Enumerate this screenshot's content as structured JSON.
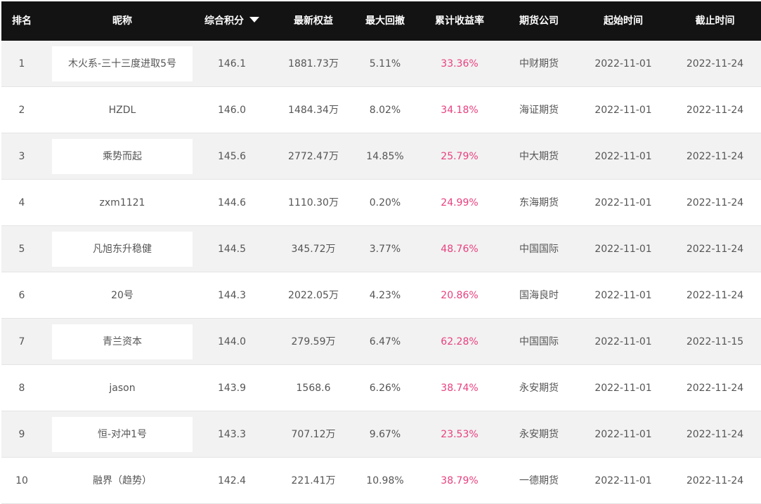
{
  "table": {
    "headers": {
      "rank": "排名",
      "nickname": "昵称",
      "score": "综合积分",
      "equity": "最新权益",
      "drawdown": "最大回撤",
      "return": "累计收益率",
      "firm": "期货公司",
      "start": "起始时间",
      "end": "截止时间"
    },
    "rows": [
      {
        "rank": "1",
        "nickname": "木火系-三十三度进取5号",
        "score": "146.1",
        "equity": "1881.73万",
        "drawdown": "5.11%",
        "return": "33.36%",
        "firm": "中财期货",
        "start": "2022-11-01",
        "end": "2022-11-24"
      },
      {
        "rank": "2",
        "nickname": "HZDL",
        "score": "146.0",
        "equity": "1484.34万",
        "drawdown": "8.02%",
        "return": "34.18%",
        "firm": "海证期货",
        "start": "2022-11-01",
        "end": "2022-11-24"
      },
      {
        "rank": "3",
        "nickname": "乘势而起",
        "score": "145.6",
        "equity": "2772.47万",
        "drawdown": "14.85%",
        "return": "25.79%",
        "firm": "中大期货",
        "start": "2022-11-01",
        "end": "2022-11-24"
      },
      {
        "rank": "4",
        "nickname": "zxm1121",
        "score": "144.6",
        "equity": "1110.30万",
        "drawdown": "0.20%",
        "return": "24.99%",
        "firm": "东海期货",
        "start": "2022-11-01",
        "end": "2022-11-24"
      },
      {
        "rank": "5",
        "nickname": "凡旭东升稳健",
        "score": "144.5",
        "equity": "345.72万",
        "drawdown": "3.77%",
        "return": "48.76%",
        "firm": "中国国际",
        "start": "2022-11-01",
        "end": "2022-11-24"
      },
      {
        "rank": "6",
        "nickname": "20号",
        "score": "144.3",
        "equity": "2022.05万",
        "drawdown": "4.23%",
        "return": "20.86%",
        "firm": "国海良时",
        "start": "2022-11-01",
        "end": "2022-11-24"
      },
      {
        "rank": "7",
        "nickname": "青兰资本",
        "score": "144.0",
        "equity": "279.59万",
        "drawdown": "6.47%",
        "return": "62.28%",
        "firm": "中国国际",
        "start": "2022-11-01",
        "end": "2022-11-15"
      },
      {
        "rank": "8",
        "nickname": "jason",
        "score": "143.9",
        "equity": "1568.6",
        "drawdown": "6.26%",
        "return": "38.74%",
        "firm": "永安期货",
        "start": "2022-11-01",
        "end": "2022-11-24"
      },
      {
        "rank": "9",
        "nickname": "恒-对冲1号",
        "score": "143.3",
        "equity": "707.12万",
        "drawdown": "9.67%",
        "return": "23.53%",
        "firm": "永安期货",
        "start": "2022-11-01",
        "end": "2022-11-24"
      },
      {
        "rank": "10",
        "nickname": "融界（趋势）",
        "score": "142.4",
        "equity": "221.41万",
        "drawdown": "10.98%",
        "return": "38.79%",
        "firm": "一德期货",
        "start": "2022-11-01",
        "end": "2022-11-24"
      }
    ]
  },
  "colors": {
    "header_bg": "#131313",
    "return_text": "#e8407f",
    "row_alt_bg": "#f2f2f2"
  },
  "icons": {
    "sort": "sort-descending-triangle-icon"
  }
}
